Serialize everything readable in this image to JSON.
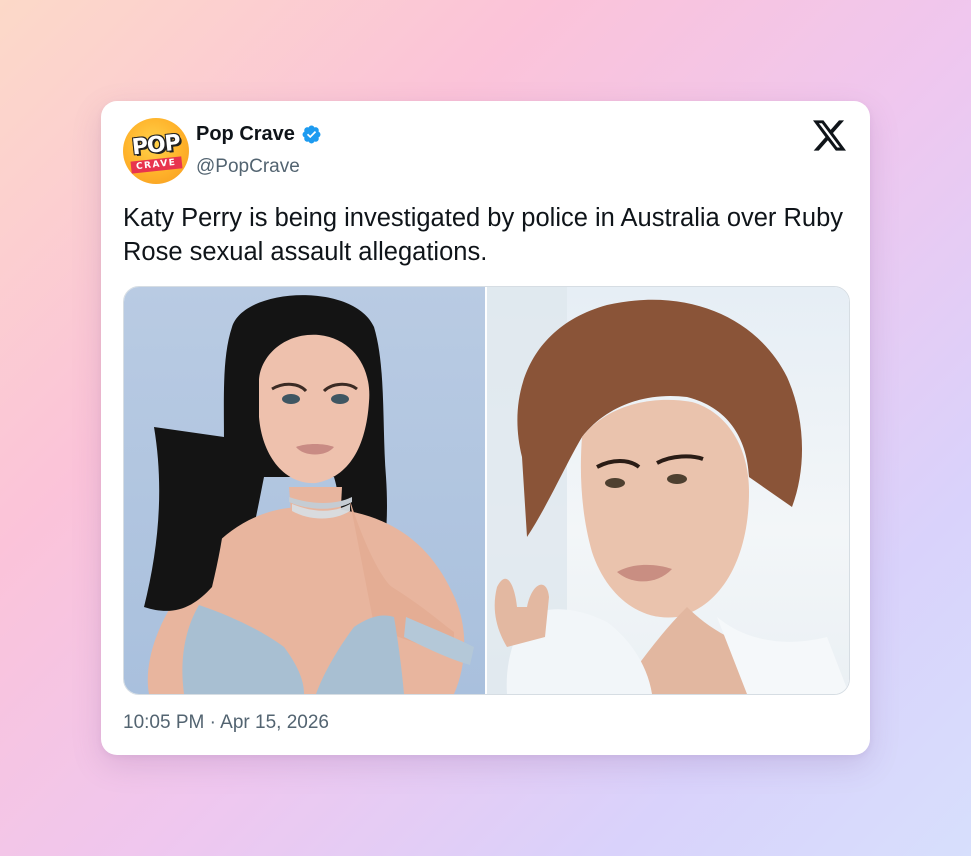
{
  "tweet": {
    "author": {
      "display_name": "Pop Crave",
      "handle": "@PopCrave",
      "avatar_text_top": "POP",
      "avatar_text_bottom": "CRAVE",
      "verified": true,
      "verified_color": "#1d9bf0"
    },
    "platform_icon": "x-logo-icon",
    "text": "Katy Perry is being investigated by police in Australia over Ruby Rose sexual assault allegations.",
    "media": [
      {
        "name": "photo-katy-perry"
      },
      {
        "name": "photo-ruby-rose"
      }
    ],
    "timestamp": "10:05 PM · Apr 15, 2026"
  },
  "colors": {
    "text_primary": "#0f1419",
    "text_secondary": "#536471",
    "avatar_bg": "#ffb22a",
    "avatar_band": "#e8344e"
  }
}
